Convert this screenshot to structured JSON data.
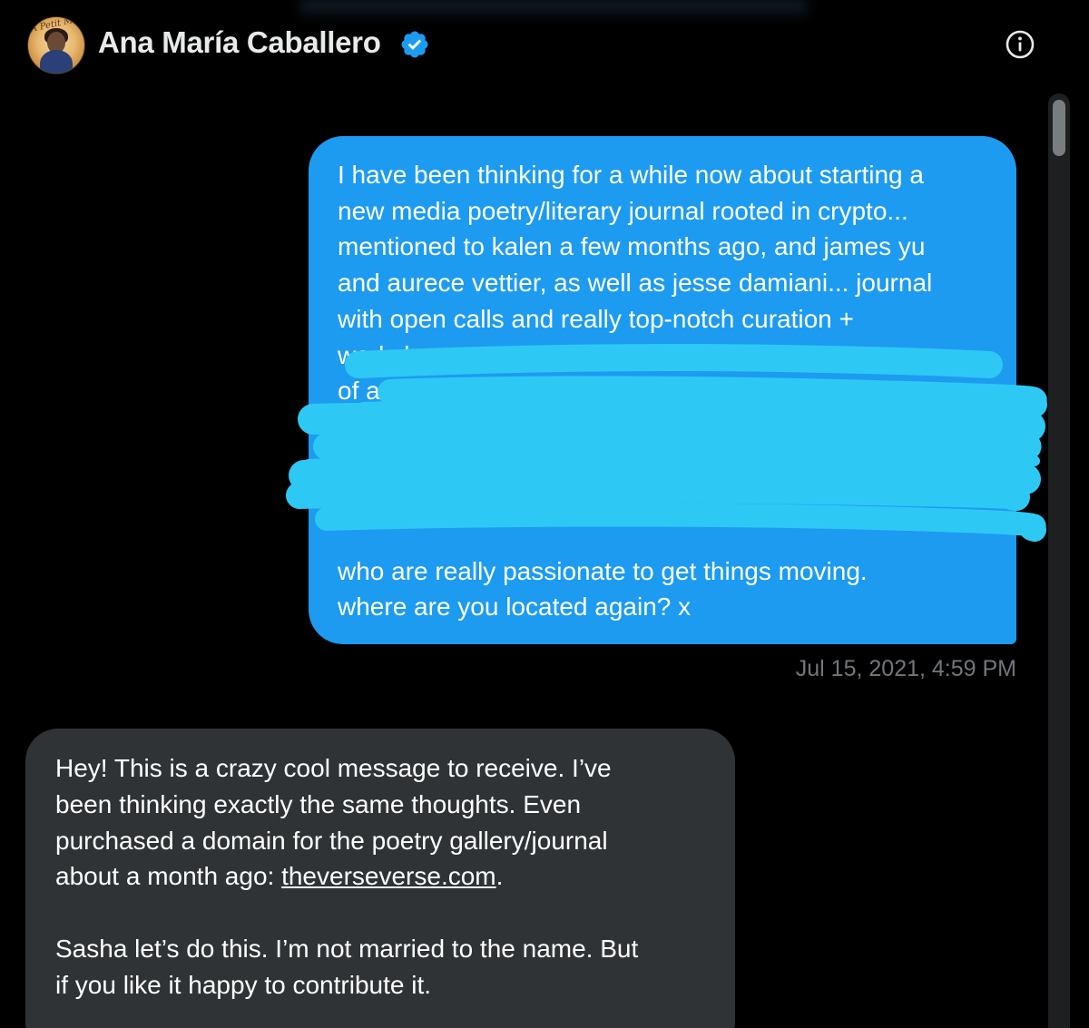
{
  "header": {
    "avatar_text": "A Petit Mot",
    "contact_name": "Ana María Caballero",
    "verified_icon": "verified-badge-icon",
    "info_icon": "info-icon"
  },
  "colors": {
    "background": "#000000",
    "sent_bubble": "#1d9bf0",
    "received_bubble": "#2f3336",
    "timestamp": "#71767b",
    "redaction_marker": "#2ec8f5"
  },
  "messages": {
    "sent": {
      "lines": [
        "I have been thinking for a while now about starting a",
        "new media poetry/literary journal rooted in crypto...",
        "mentioned to kalen a few months ago, and james yu",
        "and aurece vettier, as well as jesse damiani... journal",
        "with open calls and really top-notch curation +",
        "workshops + conference etc... was ",
        "of a ",
        "",
        "",
        "",
        "",
        "who are really passionate to get things moving.",
        "where are you located again? x"
      ],
      "timestamp": "Jul 15, 2021, 4:59 PM"
    },
    "received": {
      "line_1": "Hey! This is a crazy cool message to receive. I’ve",
      "line_2": "been thinking exactly the same thoughts. Even",
      "line_3": "purchased a domain for the poetry gallery/journal",
      "line_4_prefix": "about a month ago: ",
      "link": "theverseverse.com",
      "line_4_suffix": ".",
      "line_5": "Sasha let’s do this. I’m not married to the name. But",
      "line_6": "if you like it happy to contribute it."
    }
  }
}
